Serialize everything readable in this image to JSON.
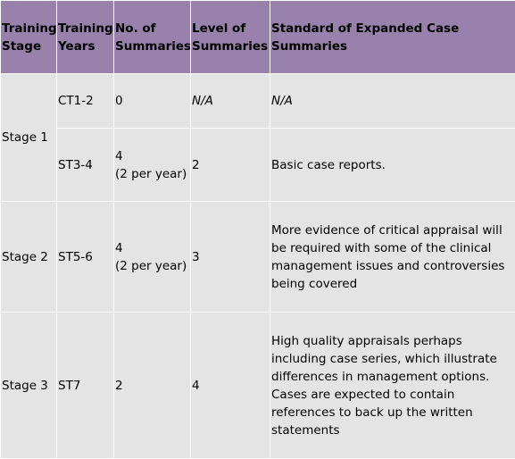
{
  "table": {
    "headers": {
      "stage": [
        "Training",
        "Stage"
      ],
      "years": [
        "Training",
        "Years"
      ],
      "count": [
        "No. of",
        "Summaries"
      ],
      "level": [
        "Level of",
        "Summaries"
      ],
      "standard": "Standard of Expanded Case Summaries"
    },
    "rows": [
      {
        "stage": "Stage 1",
        "years": "CT1-2",
        "count": "0",
        "count_note": "",
        "level": "N/A",
        "standard": "N/A"
      },
      {
        "years": "ST3-4",
        "count": "4",
        "count_note": "(2 per year)",
        "level": "2",
        "standard": "Basic case reports."
      },
      {
        "stage": "Stage 2",
        "years": "ST5-6",
        "count": "4",
        "count_note": "(2 per year)",
        "level": "3",
        "standard": "More evidence of critical appraisal will be required with some of the clinical management issues and controversies being covered"
      },
      {
        "stage": "Stage 3",
        "years": "ST7",
        "count": "2",
        "count_note": "",
        "level": "4",
        "standard": "High quality appraisals perhaps including case series, which illustrate differences in management options. Cases are expected to contain references to back up the written statements"
      }
    ]
  }
}
